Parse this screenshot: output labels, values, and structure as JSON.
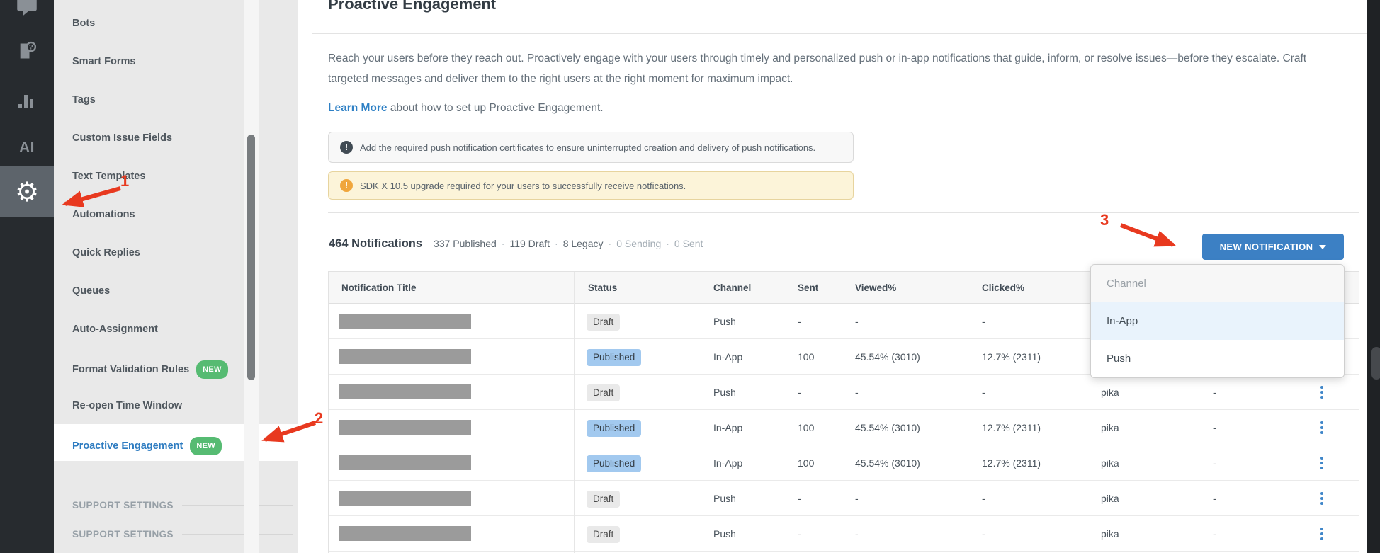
{
  "window": {
    "title": "Proactive Engagement"
  },
  "icon_rail": {
    "icons": [
      {
        "name": "chat-icon"
      },
      {
        "name": "help-faq-icon"
      },
      {
        "name": "analytics-icon"
      },
      {
        "name": "ai-icon",
        "label": "AI"
      },
      {
        "name": "settings-gear-icon",
        "selected": true
      }
    ]
  },
  "sidebar": {
    "items": [
      {
        "label": "Bots"
      },
      {
        "label": "Smart Forms"
      },
      {
        "label": "Tags"
      },
      {
        "label": "Custom Issue Fields"
      },
      {
        "label": "Text Templates"
      },
      {
        "label": "Automations"
      },
      {
        "label": "Quick Replies"
      },
      {
        "label": "Queues"
      },
      {
        "label": "Auto-Assignment"
      },
      {
        "label": "Format Validation Rules",
        "badge": "NEW"
      },
      {
        "label": "Re-open Time Window"
      },
      {
        "label": "Proactive Engagement",
        "badge": "NEW",
        "selected": true
      }
    ],
    "section_headers": [
      "SUPPORT SETTINGS",
      "SUPPORT SETTINGS"
    ]
  },
  "page": {
    "title": "Proactive Engagement",
    "description_lines": [
      "Reach your users before they reach out. Proactively engage with your users through timely and personalized push or in-app notifications that guide, inform, or resolve issues—before they escalate. Craft",
      "targeted messages and deliver them to the right users at the right moment for maximum impact."
    ],
    "learn_more_label": "Learn More",
    "learn_more_rest": " about how to set up Proactive Engagement."
  },
  "banners": [
    {
      "type": "info",
      "text": "Add the required push notification certificates to ensure uninterrupted creation and delivery of push notifications."
    },
    {
      "type": "warning",
      "text": "SDK X 10.5 upgrade required for your users to successfully receive notfications."
    }
  ],
  "summary": {
    "total": "464 Notifications",
    "stats": [
      {
        "text": "337 Published",
        "muted": false
      },
      {
        "text": "119 Draft",
        "muted": false
      },
      {
        "text": "8 Legacy",
        "muted": false
      },
      {
        "text": "0 Sending",
        "muted": true
      },
      {
        "text": "0 Sent",
        "muted": true
      }
    ]
  },
  "toolbar": {
    "new_notification_label": "NEW NOTIFICATION"
  },
  "channel_dropdown": {
    "header": "Channel",
    "options": [
      {
        "label": "In-App",
        "highlighted": true
      },
      {
        "label": "Push",
        "highlighted": false
      }
    ]
  },
  "table": {
    "columns": [
      "Notification Title",
      "Status",
      "Channel",
      "Sent",
      "Viewed%",
      "Clicked%"
    ],
    "rows": [
      {
        "status": "Draft",
        "variant": "draft",
        "channel": "Push",
        "sent": "-",
        "viewed": "-",
        "clicked": "-",
        "owner": "",
        "extra": "",
        "actions": false
      },
      {
        "status": "Published",
        "variant": "published",
        "channel": "In-App",
        "sent": "100",
        "viewed": "45.54% (3010)",
        "clicked": "12.7% (2311)",
        "owner": "",
        "extra": "",
        "actions": false
      },
      {
        "status": "Draft",
        "variant": "draft",
        "channel": "Push",
        "sent": "-",
        "viewed": "-",
        "clicked": "-",
        "owner": "pika",
        "extra": "-",
        "actions": true
      },
      {
        "status": "Published",
        "variant": "published",
        "channel": "In-App",
        "sent": "100",
        "viewed": "45.54% (3010)",
        "clicked": "12.7% (2311)",
        "owner": "pika",
        "extra": "-",
        "actions": true
      },
      {
        "status": "Published",
        "variant": "published",
        "channel": "In-App",
        "sent": "100",
        "viewed": "45.54% (3010)",
        "clicked": "12.7% (2311)",
        "owner": "pika",
        "extra": "-",
        "actions": true
      },
      {
        "status": "Draft",
        "variant": "draft",
        "channel": "Push",
        "sent": "-",
        "viewed": "-",
        "clicked": "-",
        "owner": "pika",
        "extra": "-",
        "actions": true
      },
      {
        "status": "Draft",
        "variant": "draft",
        "channel": "Push",
        "sent": "-",
        "viewed": "-",
        "clicked": "-",
        "owner": "pika",
        "extra": "-",
        "actions": true
      }
    ]
  },
  "annotations": {
    "labels": [
      "1",
      "2",
      "3"
    ]
  },
  "colors": {
    "accent_blue": "#3c80c4",
    "link_blue": "#2e80c5",
    "new_badge_green": "#56bb72",
    "published_badge_blue": "#a2c9ef",
    "annotation_red": "#e8391f",
    "warning_icon_orange": "#f0a63c"
  }
}
